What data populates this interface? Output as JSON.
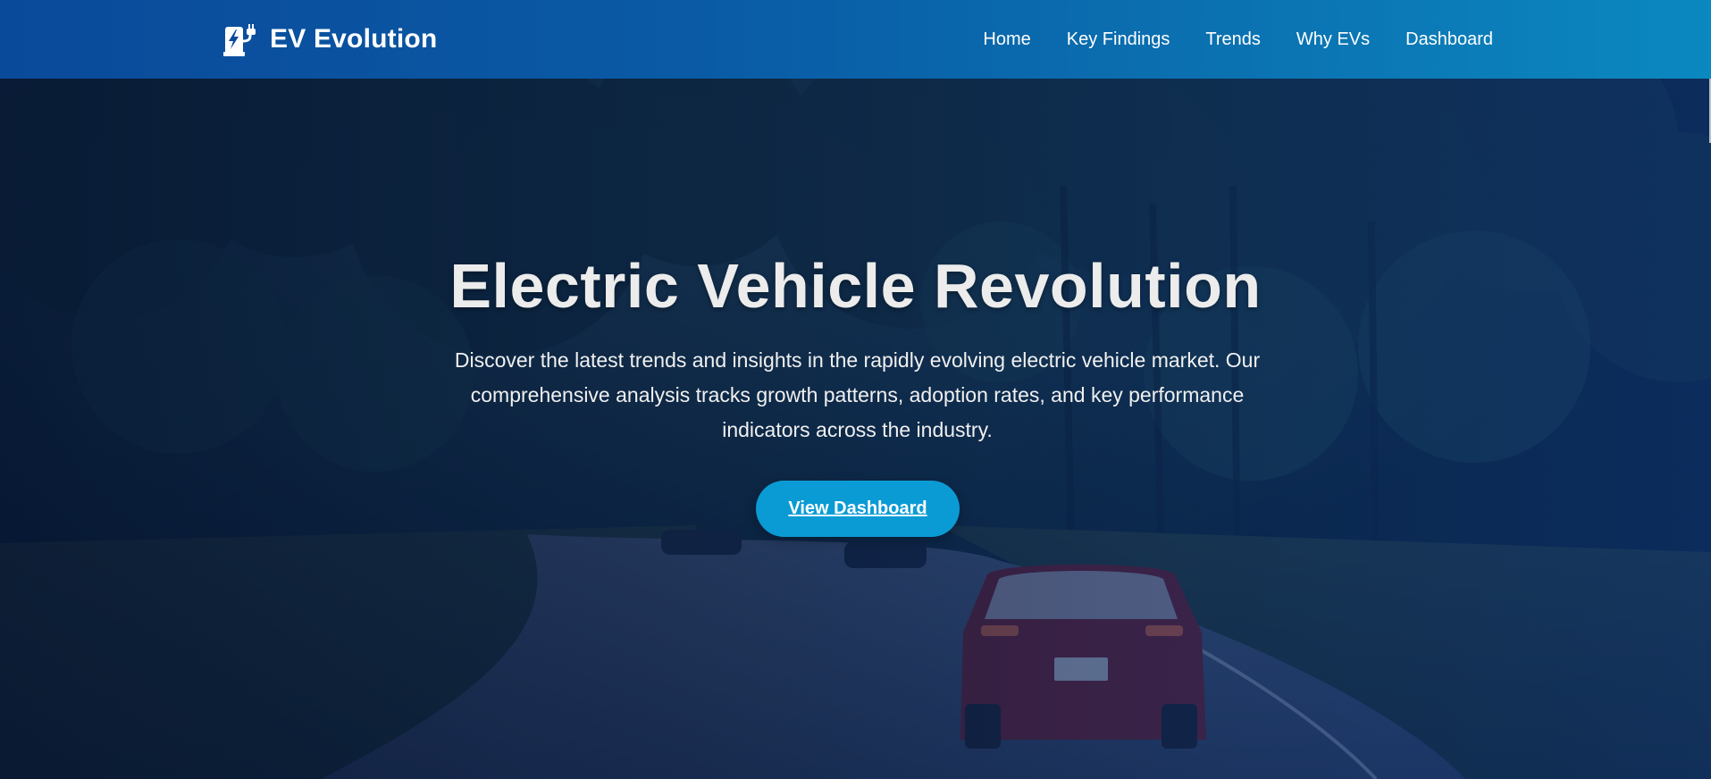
{
  "brand": {
    "name": "EV Evolution",
    "icon": "charging-station-icon"
  },
  "nav": {
    "items": [
      {
        "label": "Home"
      },
      {
        "label": "Key Findings"
      },
      {
        "label": "Trends"
      },
      {
        "label": "Why EVs"
      },
      {
        "label": "Dashboard"
      }
    ]
  },
  "hero": {
    "title": "Electric Vehicle Revolution",
    "description": "Discover the latest trends and insights in the rapidly evolving electric vehicle market. Our comprehensive analysis tracks growth patterns, adoption rates, and key performance indicators across the industry.",
    "cta_label": "View Dashboard"
  },
  "colors": {
    "header_start": "#0a4a9a",
    "header_end": "#0b88c0",
    "cta": "#0b9bd4",
    "title": "#ececec"
  }
}
